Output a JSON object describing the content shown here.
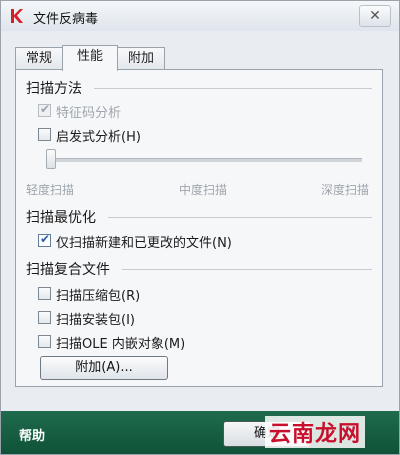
{
  "window": {
    "title": "文件反病毒",
    "close_glyph": "✕"
  },
  "tabs": [
    {
      "label": "常规"
    },
    {
      "label": "性能",
      "active": true
    },
    {
      "label": "附加"
    }
  ],
  "scan_method": {
    "title": "扫描方法",
    "options": [
      {
        "label": "特征码分析",
        "checked": true,
        "enabled": false
      },
      {
        "label": "启发式分析(H)",
        "checked": false,
        "enabled": true
      }
    ],
    "slider": {
      "labels": [
        "轻度扫描",
        "中度扫描",
        "深度扫描"
      ],
      "value": 0,
      "enabled": false
    }
  },
  "scan_optimization": {
    "title": "扫描最优化",
    "options": [
      {
        "label": "仅扫描新建和已更改的文件(N)",
        "checked": true
      }
    ]
  },
  "scan_compound": {
    "title": "扫描复合文件",
    "options": [
      {
        "label": "扫描压缩包(R)",
        "checked": false
      },
      {
        "label": "扫描安装包(I)",
        "checked": false
      },
      {
        "label": "扫描OLE 内嵌对象(M)",
        "checked": false
      }
    ],
    "additional_button": "附加(A)..."
  },
  "footer": {
    "help_label": "帮助",
    "ok_label": "确定"
  },
  "watermark": {
    "text": "云南龙网"
  },
  "colors": {
    "footer_bg": "#175f44",
    "check_color": "#2c5fa2",
    "watermark": "#c8102e",
    "brand_red": "#d42027"
  },
  "icons": {
    "app": "kaspersky-k-icon",
    "check": "✔"
  }
}
